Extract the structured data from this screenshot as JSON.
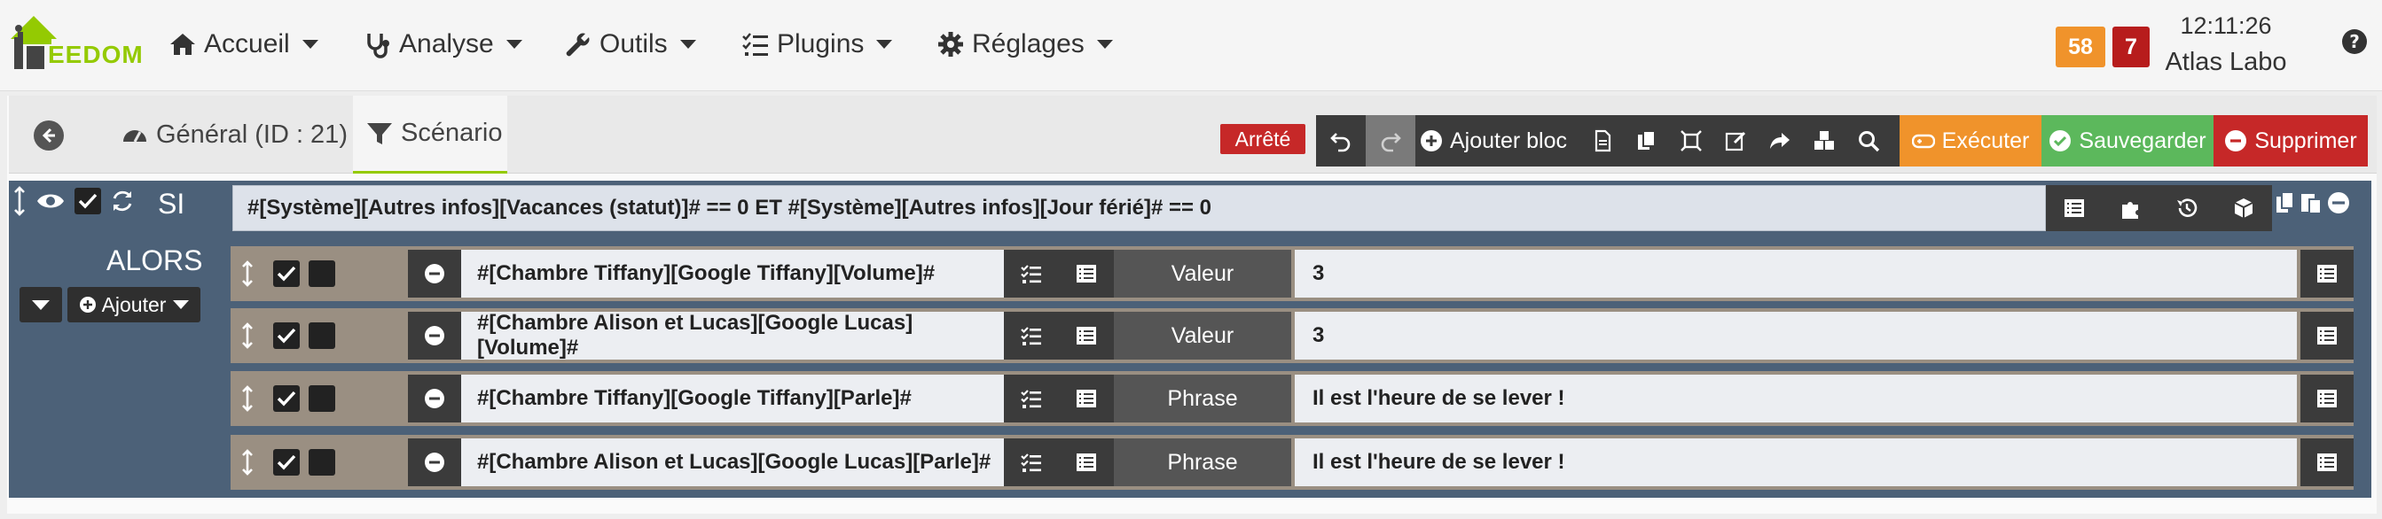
{
  "app": {
    "logo_text": "EEDOM"
  },
  "nav": {
    "items": [
      {
        "label": "Accueil",
        "icon": "home-icon"
      },
      {
        "label": "Analyse",
        "icon": "stethoscope-icon"
      },
      {
        "label": "Outils",
        "icon": "wrench-icon"
      },
      {
        "label": "Plugins",
        "icon": "list-check-icon"
      },
      {
        "label": "Réglages",
        "icon": "gear-icon"
      }
    ],
    "badge_warning": "58",
    "badge_danger": "7",
    "time": "12:11:26",
    "site_name": "Atlas Labo"
  },
  "tabs": {
    "general": "Général (ID : 21)",
    "scenario": "Scénario"
  },
  "toolbar": {
    "state": "Arrêté",
    "add_block": "Ajouter bloc",
    "execute": "Exécuter",
    "save": "Sauvegarder",
    "delete": "Supprimer"
  },
  "colors": {
    "brand_green": "#94ca02",
    "execute": "#f0932b",
    "save": "#5cb85c",
    "delete": "#c62828",
    "block_bg": "#4c6178"
  },
  "block": {
    "si_label": "SI",
    "condition": "#[Système][Autres infos][Vacances (statut)]# == 0 ET #[Système][Autres infos][Jour férié]# == 0",
    "alors_label": "ALORS",
    "add_label": "Ajouter",
    "actions": [
      {
        "command": "#[Chambre Tiffany][Google Tiffany][Volume]#",
        "param_label": "Valeur",
        "param_value": "3"
      },
      {
        "command": "#[Chambre Alison et Lucas][Google Lucas][Volume]#",
        "param_label": "Valeur",
        "param_value": "3"
      },
      {
        "command": "#[Chambre Tiffany][Google Tiffany][Parle]#",
        "param_label": "Phrase",
        "param_value": "Il est l'heure de se lever !"
      },
      {
        "command": "#[Chambre Alison et Lucas][Google Lucas][Parle]#",
        "param_label": "Phrase",
        "param_value": "Il est l'heure de se lever !"
      }
    ]
  }
}
